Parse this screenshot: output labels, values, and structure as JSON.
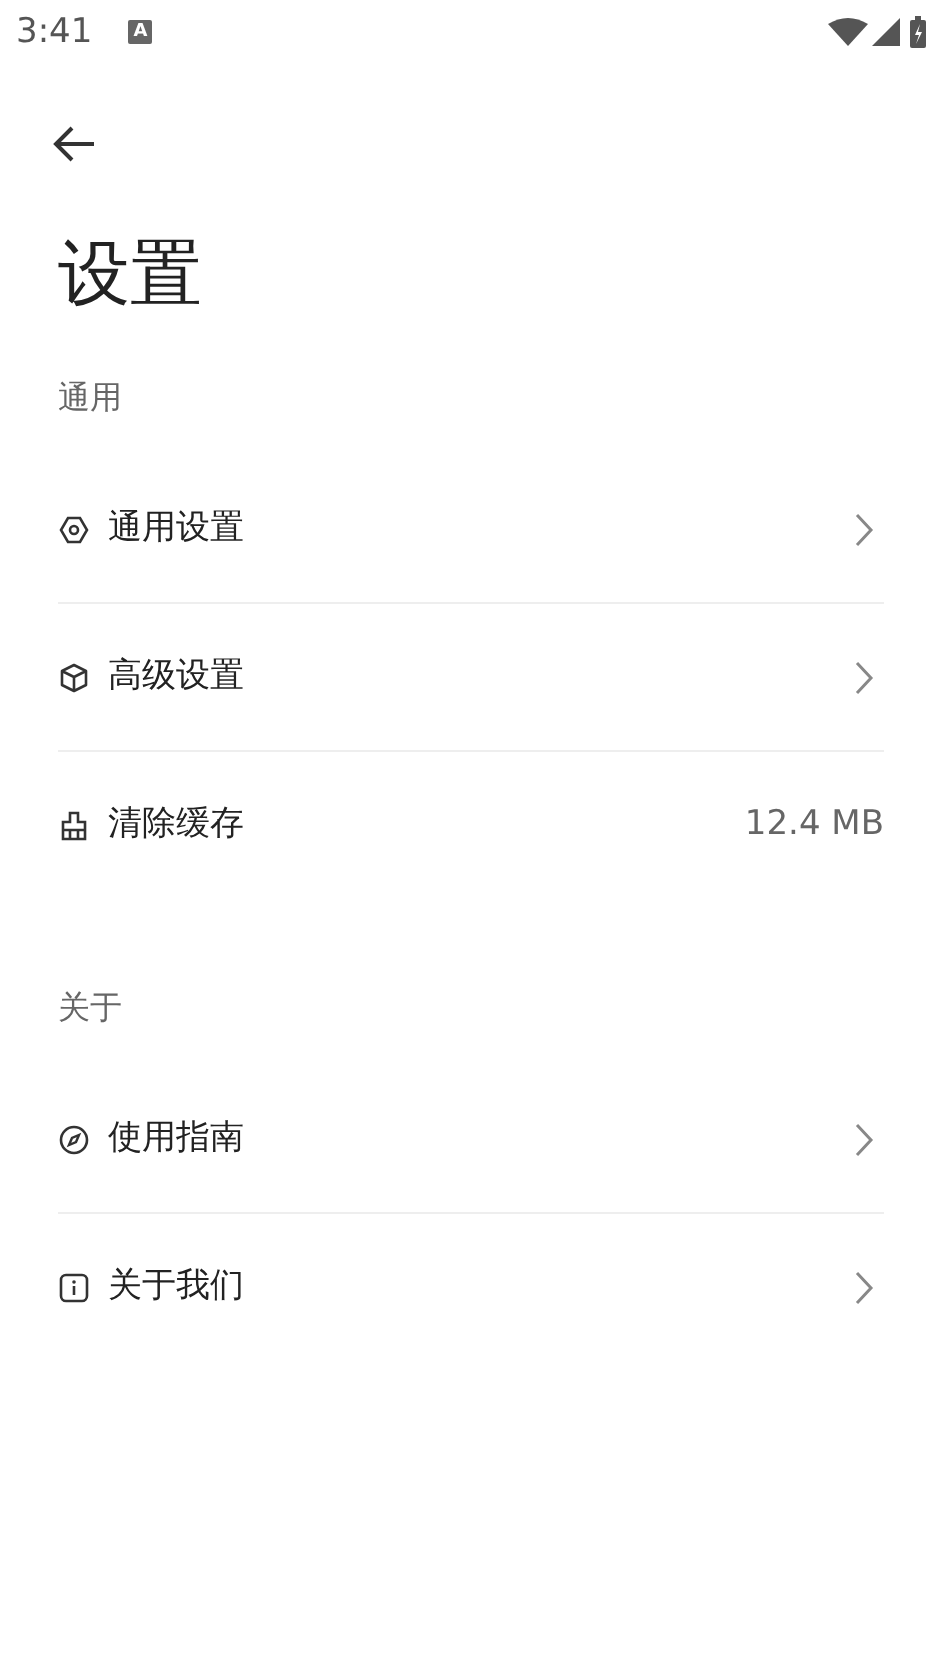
{
  "status_bar": {
    "time": "3:41",
    "notification_glyph": "A"
  },
  "title": "设置",
  "sections": [
    {
      "header": "通用",
      "items": [
        {
          "label": "通用设置",
          "kind": "link"
        },
        {
          "label": "高级设置",
          "kind": "link"
        },
        {
          "label": "清除缓存",
          "kind": "value",
          "value": "12.4 MB"
        }
      ]
    },
    {
      "header": "关于",
      "items": [
        {
          "label": "使用指南",
          "kind": "link"
        },
        {
          "label": "关于我们",
          "kind": "link"
        }
      ]
    }
  ]
}
